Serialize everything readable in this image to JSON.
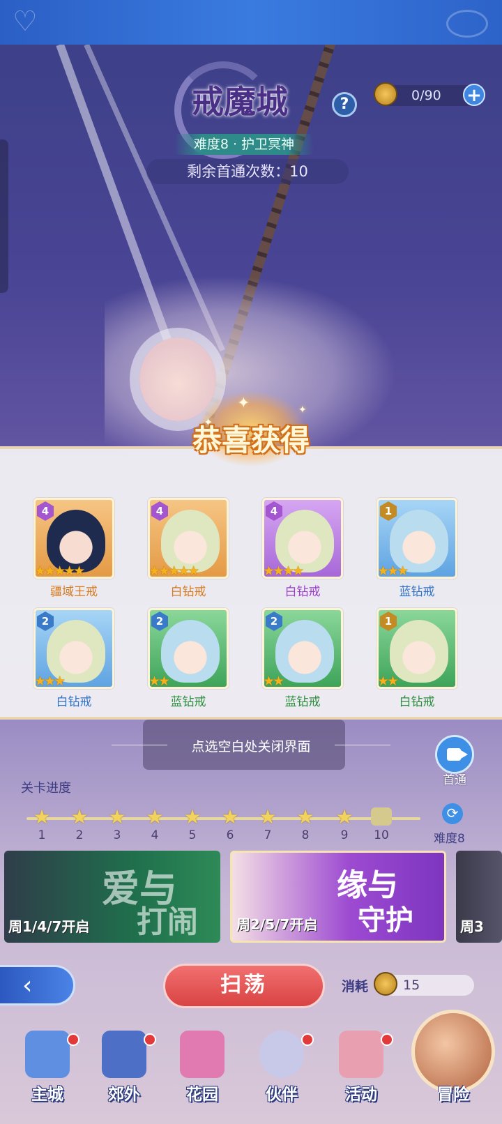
{
  "header": {
    "title": "戒魔城",
    "difficulty": "难度8 · 护卫冥神",
    "remaining_first_clear": "剩余首通次数：10",
    "help_label": "?",
    "stamina": "0/90",
    "add_label": "+"
  },
  "reward": {
    "title": "恭喜获得",
    "items": [
      {
        "grade": "4",
        "stars": "★★★★★",
        "label": "疆域王戒",
        "frame": "orange",
        "label_color": "orange"
      },
      {
        "grade": "4",
        "stars": "★★★★★",
        "label": "白钻戒",
        "frame": "orange",
        "label_color": "orange"
      },
      {
        "grade": "4",
        "stars": "★★★★",
        "label": "白钻戒",
        "frame": "purple",
        "label_color": "purple"
      },
      {
        "grade": "1",
        "stars": "★★★",
        "label": "蓝钻戒",
        "frame": "blue",
        "label_color": "blue"
      },
      {
        "grade": "2",
        "stars": "★★★",
        "label": "白钻戒",
        "frame": "blue",
        "label_color": "blue"
      },
      {
        "grade": "2",
        "stars": "★★",
        "label": "蓝钻戒",
        "frame": "green",
        "label_color": "green"
      },
      {
        "grade": "2",
        "stars": "★★",
        "label": "蓝钻戒",
        "frame": "green",
        "label_color": "green"
      },
      {
        "grade": "1",
        "stars": "★★",
        "label": "白钻戒",
        "frame": "green",
        "label_color": "green"
      }
    ],
    "close_hint": "点选空白处关闭界面"
  },
  "first_clear_label": "首通",
  "progress": {
    "label": "关卡进度",
    "stages": [
      "1",
      "2",
      "3",
      "4",
      "5",
      "6",
      "7",
      "8",
      "9",
      "10"
    ],
    "difficulty_label": "难度8"
  },
  "events": [
    {
      "title_a": "爱与",
      "title_b": "打闹",
      "days": "周1/4/7开启"
    },
    {
      "title_a": "缘与",
      "title_b": "守护",
      "days": "周2/5/7开启"
    },
    {
      "days": "周3"
    }
  ],
  "actions": {
    "sweep_label": "扫荡",
    "cost_label": "消耗",
    "cost_value": "15"
  },
  "nav": [
    {
      "label": "主城",
      "color": "#5f8fe0"
    },
    {
      "label": "郊外",
      "color": "#4d6fc6"
    },
    {
      "label": "花园",
      "color": "#e07ab0"
    },
    {
      "label": "伙伴",
      "color": "#c8c8e8"
    },
    {
      "label": "活动",
      "color": "#e8a0b0"
    },
    {
      "label": "冒险",
      "color": "#c8765a"
    }
  ]
}
